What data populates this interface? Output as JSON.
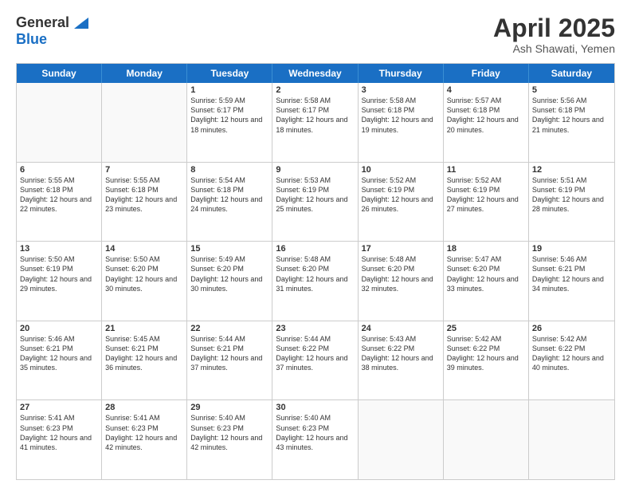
{
  "header": {
    "logo_general": "General",
    "logo_blue": "Blue",
    "title": "April 2025",
    "location": "Ash Shawati, Yemen"
  },
  "calendar": {
    "days_of_week": [
      "Sunday",
      "Monday",
      "Tuesday",
      "Wednesday",
      "Thursday",
      "Friday",
      "Saturday"
    ],
    "weeks": [
      [
        {
          "day": "",
          "empty": true
        },
        {
          "day": "",
          "empty": true
        },
        {
          "day": "1",
          "sunrise": "5:59 AM",
          "sunset": "6:17 PM",
          "daylight": "12 hours and 18 minutes."
        },
        {
          "day": "2",
          "sunrise": "5:58 AM",
          "sunset": "6:17 PM",
          "daylight": "12 hours and 18 minutes."
        },
        {
          "day": "3",
          "sunrise": "5:58 AM",
          "sunset": "6:18 PM",
          "daylight": "12 hours and 19 minutes."
        },
        {
          "day": "4",
          "sunrise": "5:57 AM",
          "sunset": "6:18 PM",
          "daylight": "12 hours and 20 minutes."
        },
        {
          "day": "5",
          "sunrise": "5:56 AM",
          "sunset": "6:18 PM",
          "daylight": "12 hours and 21 minutes."
        }
      ],
      [
        {
          "day": "6",
          "sunrise": "5:55 AM",
          "sunset": "6:18 PM",
          "daylight": "12 hours and 22 minutes."
        },
        {
          "day": "7",
          "sunrise": "5:55 AM",
          "sunset": "6:18 PM",
          "daylight": "12 hours and 23 minutes."
        },
        {
          "day": "8",
          "sunrise": "5:54 AM",
          "sunset": "6:18 PM",
          "daylight": "12 hours and 24 minutes."
        },
        {
          "day": "9",
          "sunrise": "5:53 AM",
          "sunset": "6:19 PM",
          "daylight": "12 hours and 25 minutes."
        },
        {
          "day": "10",
          "sunrise": "5:52 AM",
          "sunset": "6:19 PM",
          "daylight": "12 hours and 26 minutes."
        },
        {
          "day": "11",
          "sunrise": "5:52 AM",
          "sunset": "6:19 PM",
          "daylight": "12 hours and 27 minutes."
        },
        {
          "day": "12",
          "sunrise": "5:51 AM",
          "sunset": "6:19 PM",
          "daylight": "12 hours and 28 minutes."
        }
      ],
      [
        {
          "day": "13",
          "sunrise": "5:50 AM",
          "sunset": "6:19 PM",
          "daylight": "12 hours and 29 minutes."
        },
        {
          "day": "14",
          "sunrise": "5:50 AM",
          "sunset": "6:20 PM",
          "daylight": "12 hours and 30 minutes."
        },
        {
          "day": "15",
          "sunrise": "5:49 AM",
          "sunset": "6:20 PM",
          "daylight": "12 hours and 30 minutes."
        },
        {
          "day": "16",
          "sunrise": "5:48 AM",
          "sunset": "6:20 PM",
          "daylight": "12 hours and 31 minutes."
        },
        {
          "day": "17",
          "sunrise": "5:48 AM",
          "sunset": "6:20 PM",
          "daylight": "12 hours and 32 minutes."
        },
        {
          "day": "18",
          "sunrise": "5:47 AM",
          "sunset": "6:20 PM",
          "daylight": "12 hours and 33 minutes."
        },
        {
          "day": "19",
          "sunrise": "5:46 AM",
          "sunset": "6:21 PM",
          "daylight": "12 hours and 34 minutes."
        }
      ],
      [
        {
          "day": "20",
          "sunrise": "5:46 AM",
          "sunset": "6:21 PM",
          "daylight": "12 hours and 35 minutes."
        },
        {
          "day": "21",
          "sunrise": "5:45 AM",
          "sunset": "6:21 PM",
          "daylight": "12 hours and 36 minutes."
        },
        {
          "day": "22",
          "sunrise": "5:44 AM",
          "sunset": "6:21 PM",
          "daylight": "12 hours and 37 minutes."
        },
        {
          "day": "23",
          "sunrise": "5:44 AM",
          "sunset": "6:22 PM",
          "daylight": "12 hours and 37 minutes."
        },
        {
          "day": "24",
          "sunrise": "5:43 AM",
          "sunset": "6:22 PM",
          "daylight": "12 hours and 38 minutes."
        },
        {
          "day": "25",
          "sunrise": "5:42 AM",
          "sunset": "6:22 PM",
          "daylight": "12 hours and 39 minutes."
        },
        {
          "day": "26",
          "sunrise": "5:42 AM",
          "sunset": "6:22 PM",
          "daylight": "12 hours and 40 minutes."
        }
      ],
      [
        {
          "day": "27",
          "sunrise": "5:41 AM",
          "sunset": "6:23 PM",
          "daylight": "12 hours and 41 minutes."
        },
        {
          "day": "28",
          "sunrise": "5:41 AM",
          "sunset": "6:23 PM",
          "daylight": "12 hours and 42 minutes."
        },
        {
          "day": "29",
          "sunrise": "5:40 AM",
          "sunset": "6:23 PM",
          "daylight": "12 hours and 42 minutes."
        },
        {
          "day": "30",
          "sunrise": "5:40 AM",
          "sunset": "6:23 PM",
          "daylight": "12 hours and 43 minutes."
        },
        {
          "day": "",
          "empty": true
        },
        {
          "day": "",
          "empty": true
        },
        {
          "day": "",
          "empty": true
        }
      ]
    ]
  }
}
